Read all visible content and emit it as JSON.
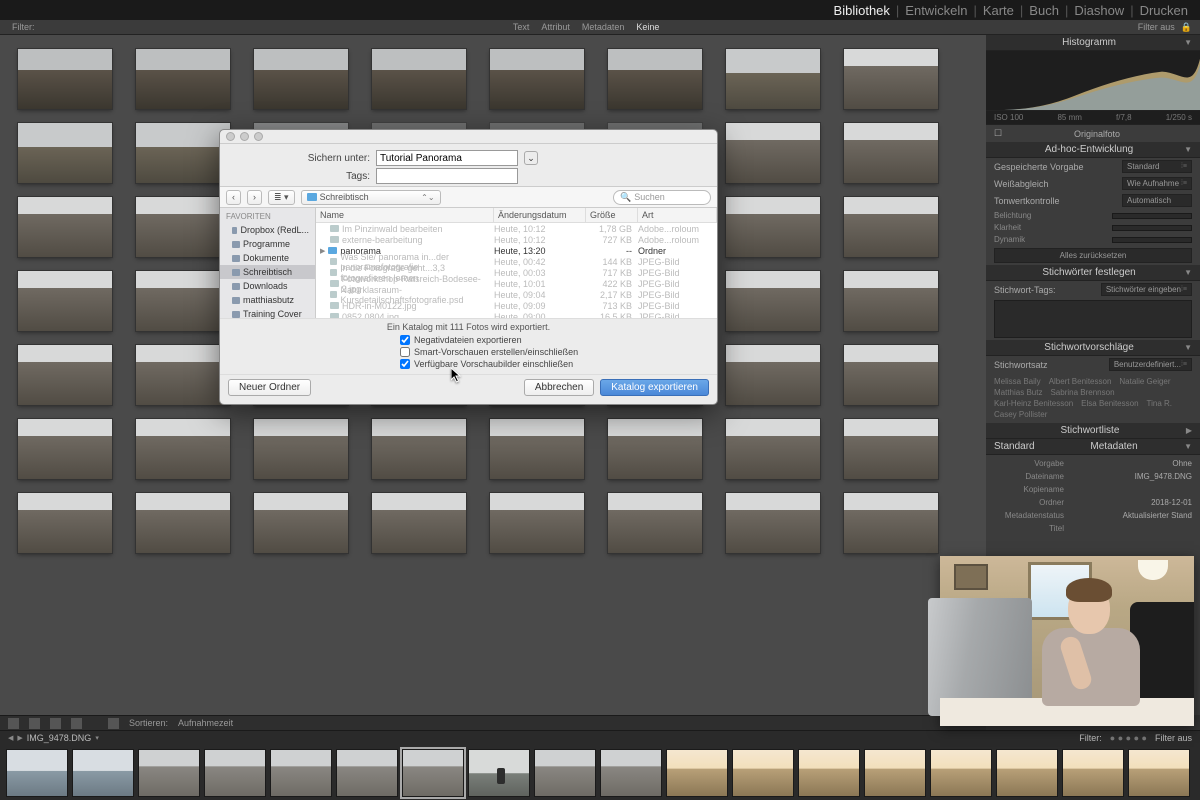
{
  "modules": {
    "library": "Bibliothek",
    "develop": "Entwickeln",
    "map": "Karte",
    "book": "Buch",
    "slideshow": "Diashow",
    "print": "Drucken",
    "active": "Bibliothek"
  },
  "filterbar": {
    "left": "Filter:",
    "items": [
      "Text",
      "Attribut",
      "Metadaten",
      "Keine"
    ],
    "right": "Filter aus"
  },
  "toolbar": {
    "sort": "Sortieren:",
    "sortval": "Aufnahmezeit"
  },
  "infoline": {
    "file": "IMG_9478.DNG",
    "filter": "Filter:",
    "filteraus": "Filter aus"
  },
  "rightpanel": {
    "histogram": {
      "title": "Histogramm",
      "meta": [
        "ISO 100",
        "85 mm",
        "f/7,8",
        "1/250 s"
      ],
      "orig": "Originalfoto"
    },
    "quickdev": {
      "title": "Ad-hoc-Entwicklung",
      "preset_label": "Gespeicherte Vorgabe",
      "preset_value": "Standard",
      "wb_label": "Weißabgleich",
      "wb_value": "Wie Aufnahme",
      "tone_label": "Tonwertkontrolle",
      "auto": "Automatisch",
      "sliders": [
        "Belichtung",
        "Klarheit",
        "Dynamik"
      ],
      "reset": "Alles zurücksetzen"
    },
    "keywording": {
      "title": "Stichwörter festlegen",
      "tags_label": "Stichwort-Tags:",
      "tags_mode": "Stichwörter eingeben"
    },
    "suggest": {
      "title": "Stichwortvorschläge"
    },
    "keyset": {
      "title": "Stichwortsatz",
      "value": "Benutzerdefiniert...",
      "names": [
        "Melissa Baily",
        "Albert Benitesson",
        "Natalie Geiger",
        "Matthias Butz",
        "Sabrina Brennson",
        "Karl-Heinz Benitesson",
        "Elsa Benitesson",
        "Tina R.",
        "Casey Pollister"
      ]
    },
    "keylist": {
      "title": "Stichwortliste"
    },
    "metadata": {
      "title": "Metadaten",
      "mode": "Standard",
      "preset_label": "Vorgabe",
      "preset_value": "Ohne",
      "rows": {
        "Dateiname": "IMG_9478.DNG",
        "Kopiename": "",
        "Ordner": "2018-12-01",
        "Metadatenstatus": "Aktualisierter Stand"
      },
      "more": "Titel"
    }
  },
  "dialog": {
    "save_as_label": "Sichern unter:",
    "save_as_value": "Tutorial Panorama",
    "tags_label": "Tags:",
    "location": "Schreibtisch",
    "search_placeholder": "Suchen",
    "sidebar_head": "Favoriten",
    "sidebar": [
      {
        "label": "Dropbox (RedL...",
        "sel": false
      },
      {
        "label": "Programme",
        "sel": false
      },
      {
        "label": "Dokumente",
        "sel": false
      },
      {
        "label": "Schreibtisch",
        "sel": true
      },
      {
        "label": "Downloads",
        "sel": false
      },
      {
        "label": "matthiasbutz",
        "sel": false
      },
      {
        "label": "Training Cover",
        "sel": false
      }
    ],
    "columns": {
      "name": "Name",
      "date": "Änderungsdatum",
      "size": "Größe",
      "kind": "Art"
    },
    "files": [
      {
        "name": "Im Pinzinwald bearbeiten",
        "date": "Heute, 10:12",
        "size": "1,78 GB",
        "kind": "Adobe...roloum",
        "dark": false
      },
      {
        "name": "externe-bearbeitung",
        "date": "Heute, 10:12",
        "size": "727 KB",
        "kind": "Adobe...roloum",
        "dark": false
      },
      {
        "name": "panorama",
        "date": "Heute, 13:20",
        "size": "--",
        "kind": "Ordner",
        "dark": true,
        "folder": true
      },
      {
        "name": "Was Sie/ panorama in...der panoramafotografie",
        "date": "Heute, 00:42",
        "size": "144 KB",
        "kind": "JPEG-Bild",
        "dark": false
      },
      {
        "name": "in die Fotografie geht...3,3 fotografieren lernen",
        "date": "Heute, 00:03",
        "size": "717 KB",
        "kind": "JPEG-Bild",
        "dark": false
      },
      {
        "name": "Fotoworkshop-Ratsreich-Bodesee-2.jpg",
        "date": "Heute, 10:01",
        "size": "422 KB",
        "kind": "JPEG-Bild",
        "dark": false
      },
      {
        "name": "Naturklasraum-Kursdetailschaftsfotografie.psd",
        "date": "Heute, 09:04",
        "size": "2,17 KB",
        "kind": "JPEG-Bild",
        "dark": false
      },
      {
        "name": "HDR-in-M0122.jpg",
        "date": "Heute, 09:09",
        "size": "713 KB",
        "kind": "JPEG-Bild",
        "dark": false
      },
      {
        "name": "0852 0804.jpg",
        "date": "Heute, 09:00",
        "size": "16,5 KB",
        "kind": "JPEG-Bild",
        "dark": false
      }
    ],
    "info": "Ein Katalog mit 111 Fotos wird exportiert.",
    "checks": {
      "negative": {
        "label": "Negativdateien exportieren",
        "checked": true
      },
      "smart": {
        "label": "Smart-Vorschauen erstellen/einschließen",
        "checked": false
      },
      "preview": {
        "label": "Verfügbare Vorschaubilder einschließen",
        "checked": true
      }
    },
    "new_folder": "Neuer Ordner",
    "cancel": "Abbrechen",
    "export": "Katalog exportieren"
  }
}
